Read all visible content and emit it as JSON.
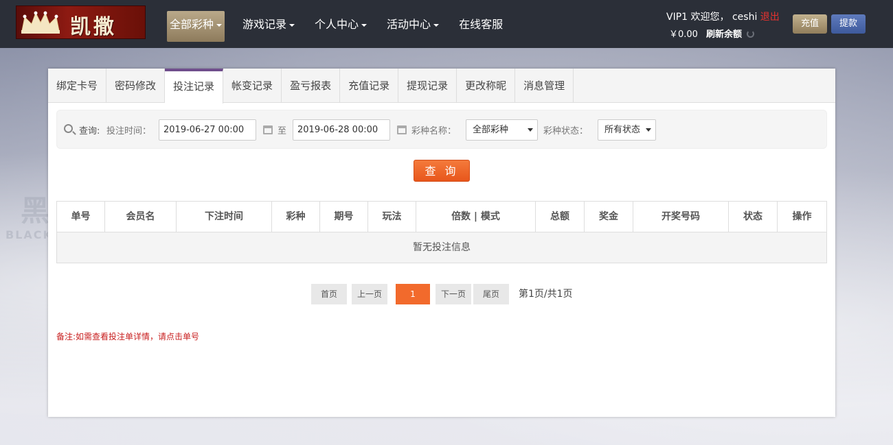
{
  "header": {
    "logo_text": "凯撒",
    "nav": [
      {
        "label": "全部彩种",
        "dropdown": true,
        "active": true
      },
      {
        "label": "游戏记录",
        "dropdown": true
      },
      {
        "label": "个人中心",
        "dropdown": true
      },
      {
        "label": "活动中心",
        "dropdown": true
      },
      {
        "label": "在线客服",
        "dropdown": false
      }
    ],
    "user": {
      "vip": "VIP1",
      "welcome": "欢迎您，",
      "username": "ceshi",
      "logout": "退出",
      "balance": "￥0.00",
      "refresh": "刷新余额"
    },
    "buttons": {
      "recharge": "充值",
      "withdraw": "提款"
    }
  },
  "tabs": [
    "绑定卡号",
    "密码修改",
    "投注记录",
    "帐变记录",
    "盈亏报表",
    "充值记录",
    "提现记录",
    "更改称昵",
    "消息管理"
  ],
  "active_tab": "投注记录",
  "search": {
    "label": "查询:",
    "time_label": "投注时间：",
    "start_time": "2019-06-27 00:00",
    "to": "至",
    "end_time": "2019-06-28 00:00",
    "lottery_label": "彩种名称：",
    "lottery_value": "全部彩种",
    "status_label": "彩种状态：",
    "status_value": "所有状态",
    "query_button": "查 询"
  },
  "table": {
    "columns": [
      "单号",
      "会员名",
      "下注时间",
      "彩种",
      "期号",
      "玩法",
      "倍数 | 模式",
      "总额",
      "奖金",
      "开奖号码",
      "状态",
      "操作"
    ],
    "empty_text": "暂无投注信息"
  },
  "pager": {
    "first": "首页",
    "prev": "上一页",
    "current": "1",
    "next": "下一页",
    "last": "尾页",
    "info": "第1页/共1页"
  },
  "note": "备注:如需查看投注单详情，请点击单号",
  "watermark": {
    "line1": "黑市",
    "line2": "BLACKMARKET"
  }
}
